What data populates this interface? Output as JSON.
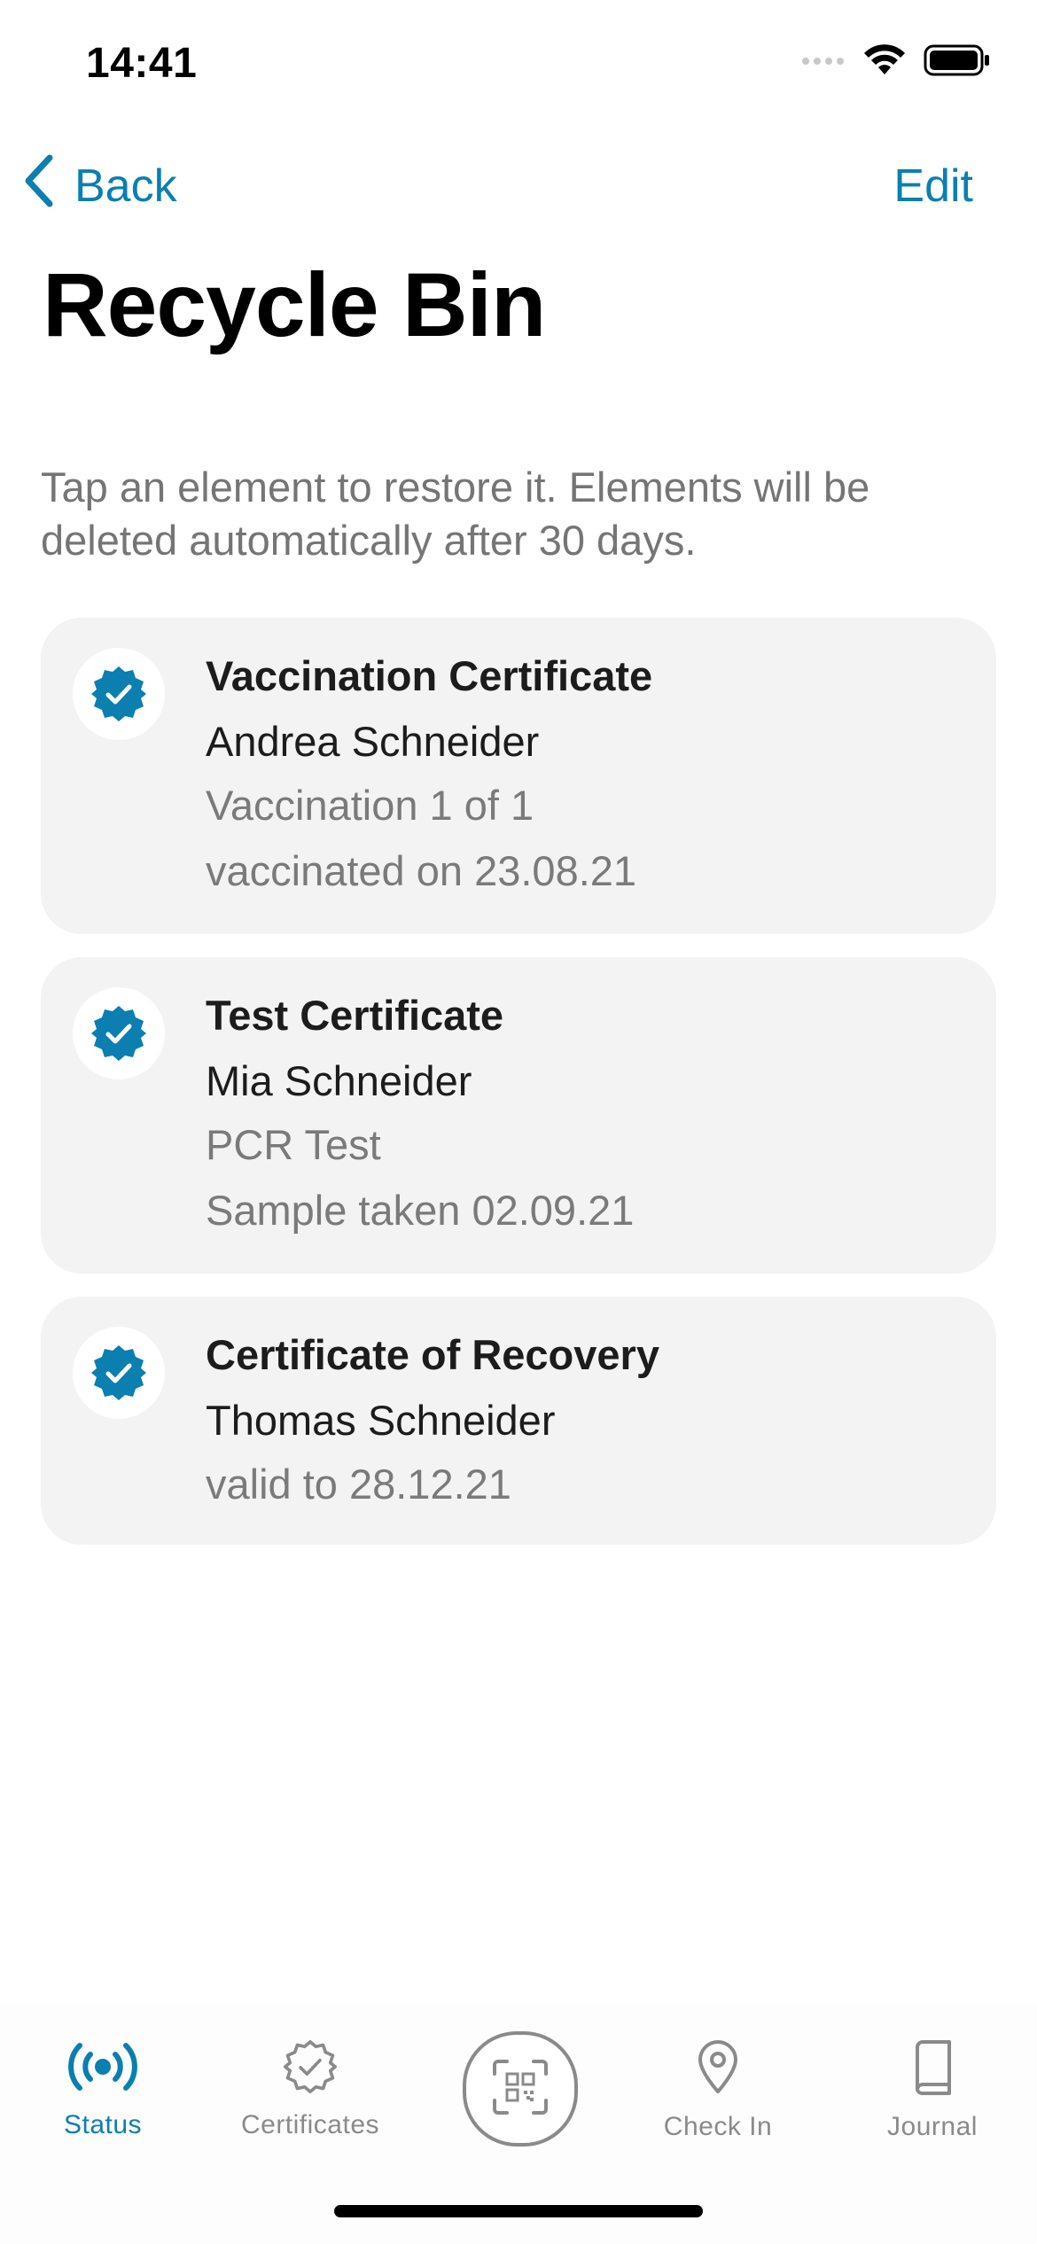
{
  "status_bar": {
    "time": "14:41"
  },
  "nav": {
    "back_label": "Back",
    "edit_label": "Edit"
  },
  "page": {
    "title": "Recycle Bin",
    "intro": "Tap an element to restore it. Elements will be deleted automatically after 30 days."
  },
  "colors": {
    "accent": "#0a7fb0",
    "card_background": "#f3f3f3",
    "secondary_text": "#757575"
  },
  "certificates": [
    {
      "title": "Vaccination Certificate",
      "name": "Andrea Schneider",
      "detail_1": "Vaccination 1 of 1",
      "detail_2": "vaccinated on 23.08.21",
      "icon": "verified-badge-icon"
    },
    {
      "title": "Test Certificate",
      "name": "Mia Schneider",
      "detail_1": "PCR Test",
      "detail_2": "Sample taken 02.09.21",
      "icon": "verified-badge-icon"
    },
    {
      "title": "Certificate of Recovery",
      "name": "Thomas Schneider",
      "detail_1": "valid to 28.12.21",
      "icon": "verified-badge-icon"
    }
  ],
  "tab_bar": {
    "tabs": [
      {
        "label": "Status",
        "icon": "broadcast-icon",
        "active": true
      },
      {
        "label": "Certificates",
        "icon": "certificate-badge-icon",
        "active": false
      },
      {
        "label": "Check In",
        "icon": "location-pin-icon",
        "active": false
      },
      {
        "label": "Journal",
        "icon": "book-icon",
        "active": false
      }
    ],
    "scan_icon": "qr-scan-icon"
  }
}
